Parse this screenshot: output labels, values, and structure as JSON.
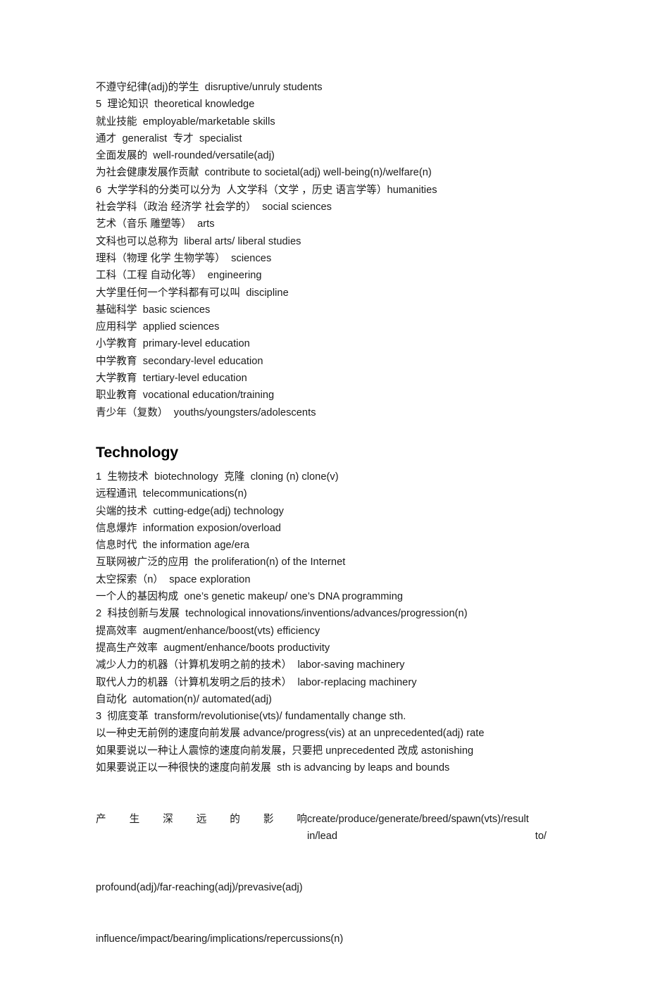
{
  "document": {
    "sections": [
      {
        "id": "education-continued",
        "heading": null,
        "lines": [
          "不遵守纪律(adj)的学生  disruptive/unruly students",
          "5  理论知识  theoretical knowledge",
          "就业技能  employable/marketable skills",
          "通才  generalist  专才  specialist",
          "全面发展的  well-rounded/versatile(adj)",
          "为社会健康发展作贡献  contribute to societal(adj) well-being(n)/welfare(n)",
          "6  大学学科的分类可以分为  人文学科（文学 ，历史 语言学等）humanities",
          "社会学科（政治 经济学 社会学的）  social sciences",
          "艺术（音乐 雕塑等）  arts",
          "文科也可以总称为  liberal arts/ liberal studies",
          "理科（物理 化学 生物学等）  sciences",
          "工科（工程 自动化等）  engineering",
          "大学里任何一个学科都有可以叫  discipline",
          "基础科学  basic sciences",
          "应用科学  applied sciences",
          "小学教育  primary-level education",
          "中学教育  secondary-level education",
          "大学教育  tertiary-level education",
          "职业教育  vocational education/training",
          "青少年（复数）  youths/youngsters/adolescents"
        ]
      },
      {
        "id": "technology",
        "heading": "Technology",
        "lines": [
          "1  生物技术  biotechnology  克隆  cloning (n) clone(v)",
          "远程通讯  telecommunications(n)",
          "尖端的技术  cutting-edge(adj) technology",
          "信息爆炸  information exposion/overload",
          "信息时代  the information age/era",
          "互联网被广泛的应用  the proliferation(n) of the Internet",
          "太空探索（n）  space exploration",
          "一个人的基因构成  one’s genetic makeup/ one’s DNA programming",
          "2  科技创新与发展  technological innovations/inventions/advances/progression(n)",
          "提高效率  augment/enhance/boost(vts) efficiency",
          "提高生产效率  augment/enhance/boots productivity",
          "减少人力的机器（计算机发明之前的技术）  labor-saving machinery",
          "取代人力的机器（计算机发明之后的技术）  labor-replacing machinery",
          "自动化  automation(n)/ automated(adj)",
          "3  彻底变革  transform/revolutionise(vts)/ fundamentally change sth.",
          "以一种史无前例的速度向前发展 advance/progress(vis) at an unprecedented(adj) rate",
          "如果要说以一种让人震惊的速度向前发展，只要把 unprecedented 改成 astonishing",
          "如果要说正以一种很快的速度向前发展  sth is advancing by leaps and bounds"
        ]
      }
    ],
    "justified_paragraph": {
      "chinese_spread": "产生深远的影响",
      "english_run": "create/produce/generate/breed/spawn(vts)/result   in/lead   to/",
      "line2": "profound(adj)/far-reaching(adj)/prevasive(adj)",
      "line3": "influence/impact/bearing/implications/repercussions(n)"
    }
  }
}
